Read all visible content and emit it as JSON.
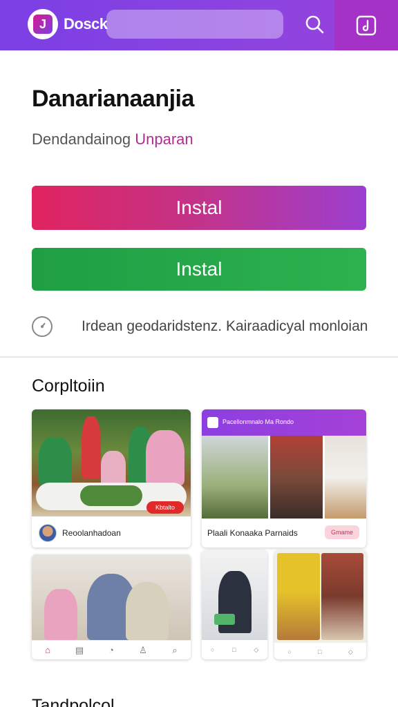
{
  "header": {
    "brand": "Dosck",
    "search_placeholder": "",
    "icons": {
      "logo": "app-logo-icon",
      "search": "search-icon",
      "action": "music-note-icon"
    }
  },
  "app": {
    "title": "Danarianaanjia",
    "subtitle_prefix": "Dendandainog ",
    "subtitle_accent": "Unparan",
    "accent_color": "#b32a8e"
  },
  "buttons": {
    "install_primary": "Instal",
    "install_secondary": "Instal"
  },
  "info": {
    "icon": "info-icon",
    "text": "Irdean geodaridstenz. Kairaadicyal monloian"
  },
  "section": {
    "title": "Corpltoiin"
  },
  "cards": {
    "card1_label": "Reoolanhadoan",
    "card1_badge": "Kbtalto",
    "card2_header": "Pacellonmnalo Ma Rondo",
    "card2_label": "Plaali Konaaka Parnaids",
    "card2_chip": "Gmame"
  },
  "bottom": {
    "title": "Tandpolcol",
    "more": "..."
  },
  "colors": {
    "header": "#8a40e0",
    "install_gradient_start": "#e0245e",
    "install_gradient_end": "#9c3fd0",
    "install_green": "#2db24f"
  }
}
